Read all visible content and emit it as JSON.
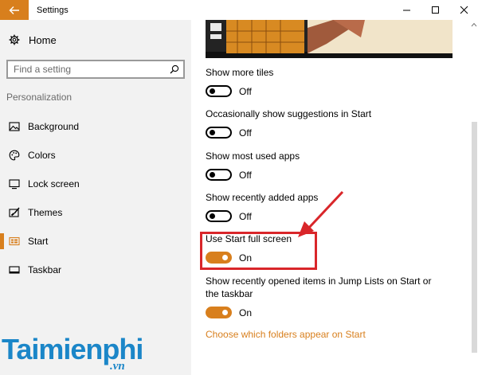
{
  "window": {
    "title": "Settings"
  },
  "sidebar": {
    "home_label": "Home",
    "search_placeholder": "Find a setting",
    "section": "Personalization",
    "items": [
      {
        "label": "Background",
        "icon": "picture-icon"
      },
      {
        "label": "Colors",
        "icon": "palette-icon"
      },
      {
        "label": "Lock screen",
        "icon": "monitor-icon"
      },
      {
        "label": "Themes",
        "icon": "brush-icon"
      },
      {
        "label": "Start",
        "icon": "start-icon",
        "active": true
      },
      {
        "label": "Taskbar",
        "icon": "taskbar-icon"
      }
    ]
  },
  "settings": [
    {
      "label": "Show more tiles",
      "state": "Off"
    },
    {
      "label": "Occasionally show suggestions in Start",
      "state": "Off"
    },
    {
      "label": "Show most used apps",
      "state": "Off"
    },
    {
      "label": "Show recently added apps",
      "state": "Off"
    },
    {
      "label": "Use Start full screen",
      "state": "On"
    },
    {
      "label": "Show recently opened items in Jump Lists on Start or the taskbar",
      "state": "On"
    }
  ],
  "link": "Choose which folders appear on Start",
  "watermark": {
    "brand": "Taimienphi",
    "suffix": ".vn"
  },
  "colors": {
    "accent": "#d87f1d",
    "annotation": "#d9262a",
    "watermark": "#1b86c8"
  }
}
